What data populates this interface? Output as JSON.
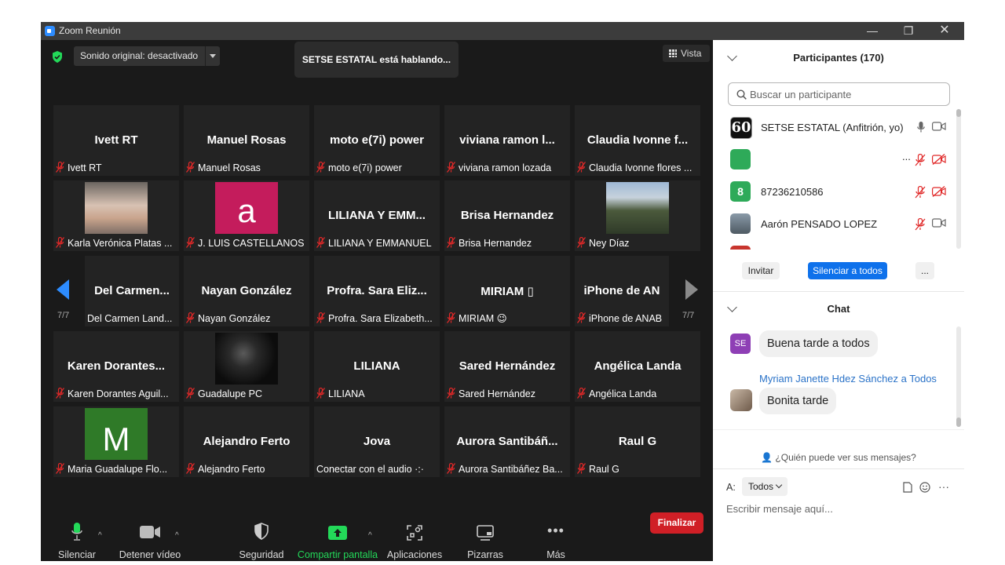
{
  "window": {
    "title": "Zoom Reunión"
  },
  "top": {
    "audio_status": "Sonido original: desactivado",
    "speaking_banner": "SETSE ESTATAL está hablando...",
    "view_label": "Vista"
  },
  "pagination": {
    "left": "7/7",
    "right": "7/7"
  },
  "tiles": [
    {
      "name": "Ivett RT",
      "label": "Ivett RT"
    },
    {
      "name": "Manuel Rosas",
      "label": "Manuel Rosas"
    },
    {
      "name": "moto e(7i) power",
      "label": "moto e(7i) power"
    },
    {
      "name": "viviana ramon l...",
      "label": "viviana ramon lozada"
    },
    {
      "name": "Claudia Ivonne f...",
      "label": "Claudia Ivonne flores ..."
    },
    {
      "name": "",
      "label": "Karla Verónica Platas ..."
    },
    {
      "name": "",
      "label": "J. LUIS CASTELLANOS",
      "avatar_letter": "a"
    },
    {
      "name": "LILIANA Y EMM...",
      "label": "LILIANA Y EMMANUEL"
    },
    {
      "name": "Brisa Hernandez",
      "label": "Brisa Hernandez"
    },
    {
      "name": "",
      "label": "Ney Díaz"
    },
    {
      "name": "Del Carmen...",
      "label": "Del Carmen Land..."
    },
    {
      "name": "Nayan González",
      "label": "Nayan González"
    },
    {
      "name": "Profra. Sara Eliz...",
      "label": "Profra. Sara Elizabeth..."
    },
    {
      "name": "MIRIAM ▯",
      "label": "MIRIAM 😉"
    },
    {
      "name": "iPhone de AN",
      "label": "iPhone de ANAB"
    },
    {
      "name": "Karen Dorantes...",
      "label": "Karen Dorantes Aguil..."
    },
    {
      "name": "",
      "label": "Guadalupe PC"
    },
    {
      "name": "LILIANA",
      "label": "LILIANA"
    },
    {
      "name": "Sared Hernández",
      "label": "Sared Hernández"
    },
    {
      "name": "Angélica Landa",
      "label": "Angélica Landa"
    },
    {
      "name": "",
      "label": "Maria Guadalupe Flo...",
      "avatar_letter": "M"
    },
    {
      "name": "Alejandro Ferto",
      "label": "Alejandro Ferto"
    },
    {
      "name": "Jova",
      "label": "Conectar con el audio ·:·"
    },
    {
      "name": "Aurora Santibáñ...",
      "label": "Aurora Santibáñez Ba..."
    },
    {
      "name": "Raul G",
      "label": "Raul G"
    }
  ],
  "toolbar": {
    "mute": "Silenciar",
    "video": "Detener vídeo",
    "security": "Seguridad",
    "share": "Compartir pantalla",
    "apps": "Aplicaciones",
    "whiteboards": "Pizarras",
    "more": "Más",
    "end": "Finalizar"
  },
  "participants": {
    "header": "Participantes (170)",
    "search_placeholder": "Buscar un participante",
    "list": [
      {
        "name": "SETSE ESTATAL (Anfitrión, yo)",
        "avatar": "60"
      },
      {
        "name": "",
        "avatar": "",
        "extra": "..."
      },
      {
        "name": "87236210586",
        "avatar": "8"
      },
      {
        "name": "Aarón PENSADO LOPEZ",
        "avatar": ""
      }
    ],
    "invite": "Invitar",
    "mute_all": "Silenciar a todos",
    "more": "..."
  },
  "chat": {
    "header": "Chat",
    "messages": [
      {
        "avatar": "SE",
        "sender": "",
        "text": "Buena tarde a todos"
      },
      {
        "avatar": "",
        "sender": "Myriam Janette Hdez Sánchez a Todos",
        "text": "Bonita tarde"
      }
    ],
    "who_can_see": "¿Quién puede ver sus mensajes?",
    "to_label": "A:",
    "to_value": "Todos",
    "input_placeholder": "Escribir mensaje aquí..."
  },
  "colors": {
    "accent": "#0e71eb",
    "end": "#d01f26",
    "share": "#23d959",
    "mute_red": "#e02828"
  }
}
